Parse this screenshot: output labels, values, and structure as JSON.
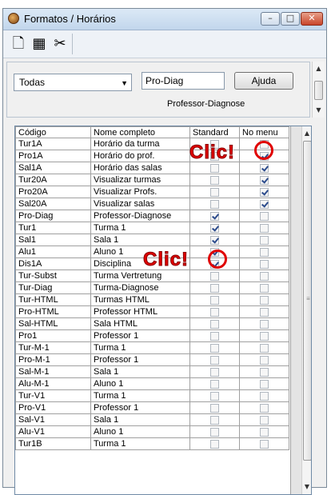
{
  "window": {
    "title": "Formatos / Horários",
    "buttons": {
      "minimize": "–",
      "maximize": "□",
      "close": "✕"
    }
  },
  "toolbar": {
    "icons": [
      "new-document-icon",
      "grid-icon",
      "scissors-icon"
    ],
    "glyphs": {
      "new": "🗋",
      "grid": "▦",
      "cut": "✂"
    }
  },
  "filter": {
    "selected": "Todas",
    "code_value": "Pro-Diag",
    "help_label": "Ajuda",
    "description": "Professor-Diagnose"
  },
  "table": {
    "headers": [
      "Código",
      "Nome completo",
      "Standard",
      "No menu"
    ],
    "rows": [
      {
        "code": "Tur1A",
        "name": "Horário da turma",
        "standard": false,
        "menu": false
      },
      {
        "code": "Pro1A",
        "name": "Horário do prof.",
        "standard": false,
        "menu": true
      },
      {
        "code": "Sal1A",
        "name": "Horário das salas",
        "standard": false,
        "menu": true
      },
      {
        "code": "Tur20A",
        "name": "Visualizar turmas",
        "standard": false,
        "menu": true
      },
      {
        "code": "Pro20A",
        "name": "Visualizar Profs.",
        "standard": false,
        "menu": true
      },
      {
        "code": "Sal20A",
        "name": "Visualizar salas",
        "standard": false,
        "menu": true
      },
      {
        "code": "Pro-Diag",
        "name": "Professor-Diagnose",
        "standard": true,
        "menu": false
      },
      {
        "code": "Tur1",
        "name": "Turma 1",
        "standard": true,
        "menu": false
      },
      {
        "code": "Sal1",
        "name": "Sala 1",
        "standard": true,
        "menu": false
      },
      {
        "code": "Alu1",
        "name": "Aluno 1",
        "standard": true,
        "menu": false
      },
      {
        "code": "Dis1A",
        "name": "Disciplina",
        "standard": true,
        "menu": false
      },
      {
        "code": "Tur-Subst",
        "name": "Turma Vertretung",
        "standard": false,
        "menu": false
      },
      {
        "code": "Tur-Diag",
        "name": "Turma-Diagnose",
        "standard": false,
        "menu": false
      },
      {
        "code": "Tur-HTML",
        "name": "Turmas HTML",
        "standard": false,
        "menu": false
      },
      {
        "code": "Pro-HTML",
        "name": "Professor HTML",
        "standard": false,
        "menu": false
      },
      {
        "code": "Sal-HTML",
        "name": "Sala HTML",
        "standard": false,
        "menu": false
      },
      {
        "code": "Pro1",
        "name": "Professor 1",
        "standard": false,
        "menu": false
      },
      {
        "code": "Tur-M-1",
        "name": "Turma 1",
        "standard": false,
        "menu": false
      },
      {
        "code": "Pro-M-1",
        "name": "Professor 1",
        "standard": false,
        "menu": false
      },
      {
        "code": "Sal-M-1",
        "name": "Sala 1",
        "standard": false,
        "menu": false
      },
      {
        "code": "Alu-M-1",
        "name": "Aluno 1",
        "standard": false,
        "menu": false
      },
      {
        "code": "Tur-V1",
        "name": "Turma 1",
        "standard": false,
        "menu": false
      },
      {
        "code": "Pro-V1",
        "name": "Professor 1",
        "standard": false,
        "menu": false
      },
      {
        "code": "Sal-V1",
        "name": "Sala 1",
        "standard": false,
        "menu": false
      },
      {
        "code": "Alu-V1",
        "name": "Aluno 1",
        "standard": false,
        "menu": false
      },
      {
        "code": "Tur1B",
        "name": "Turma 1",
        "standard": false,
        "menu": false
      }
    ]
  },
  "annotations": {
    "clic1": "Clic!",
    "clic2": "Clic!",
    "color": "#e00000"
  },
  "scroll": {
    "up": "▲",
    "down": "▼"
  }
}
